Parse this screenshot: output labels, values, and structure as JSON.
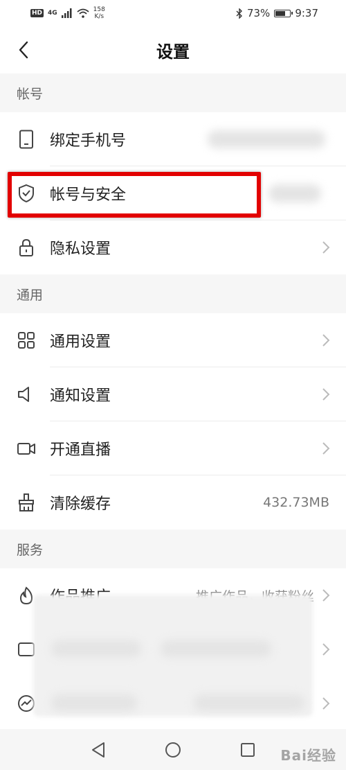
{
  "status_bar": {
    "hd_badge": "HD",
    "network": "4G",
    "speed_value": "158",
    "speed_unit": "K/s",
    "battery_level": "73%",
    "battery_fraction": 0.73,
    "time": "9:37"
  },
  "title_bar": {
    "title": "设置"
  },
  "sections": {
    "account": {
      "header": "帐号"
    },
    "general": {
      "header": "通用"
    },
    "services": {
      "header": "服务"
    }
  },
  "rows": {
    "bind_phone": {
      "label": "绑定手机号",
      "icon": "phone-icon"
    },
    "account_security": {
      "label": "帐号与安全",
      "icon": "shield-icon"
    },
    "privacy": {
      "label": "隐私设置",
      "icon": "lock-icon"
    },
    "general_settings": {
      "label": "通用设置",
      "icon": "grid-icon"
    },
    "notification": {
      "label": "通知设置",
      "icon": "speaker-icon"
    },
    "live_stream": {
      "label": "开通直播",
      "icon": "video-camera-icon"
    },
    "clear_cache": {
      "label": "清除缓存",
      "icon": "brush-icon",
      "value": "432.73MB"
    },
    "promotion": {
      "label": "作品推广",
      "icon": "fire-icon",
      "value": "推广作品，收获粉丝"
    }
  },
  "watermark": "Bai经验",
  "colors": {
    "highlight": "#e20000",
    "background": "#f6f6f6",
    "row_background": "#ffffff"
  }
}
